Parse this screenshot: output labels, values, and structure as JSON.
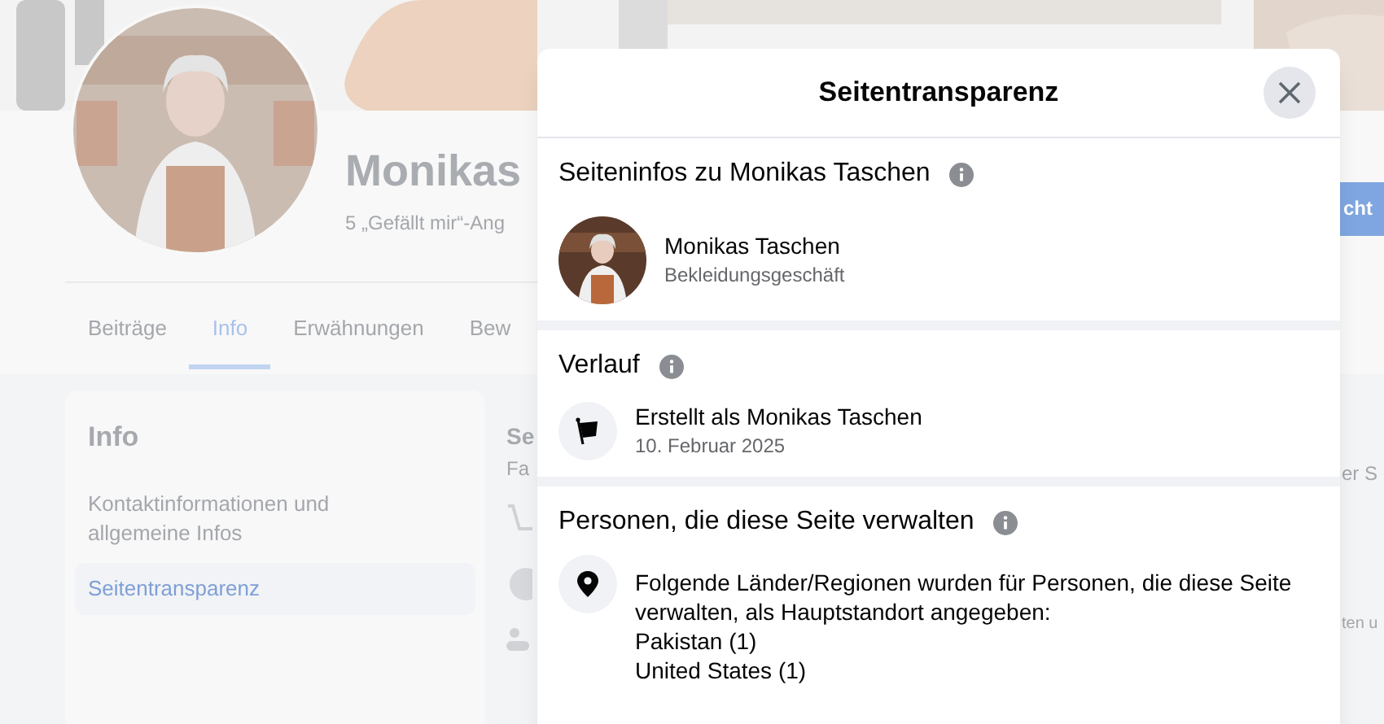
{
  "background_page": {
    "page_name": "Monikas",
    "likes": "5 „Gefällt mir“-Ang",
    "tabs": [
      {
        "label": "Beiträge",
        "selected": false
      },
      {
        "label": "Info",
        "selected": true
      },
      {
        "label": "Erwähnungen",
        "selected": false
      },
      {
        "label": "Bew",
        "selected": false
      }
    ],
    "info_card": {
      "title": "Info",
      "items": [
        {
          "label": "Kontaktinformationen und allgemeine Infos",
          "selected": false
        },
        {
          "label": "Seitentransparenz",
          "selected": true
        }
      ]
    },
    "middle_column": {
      "heading": "Se",
      "subheading": "Fa"
    },
    "right_edge": {
      "button": "cht",
      "texts": [
        "er S",
        "ten u"
      ]
    }
  },
  "dialog": {
    "title": "Seitentransparenz",
    "sections": [
      {
        "kind": "page",
        "heading": "Seiteninfos zu Monikas Taschen",
        "name": "Monikas Taschen",
        "category": "Bekleidungsgeschäft"
      },
      {
        "kind": "history",
        "heading": "Verlauf",
        "title": "Erstellt als Monikas Taschen",
        "date": "10. Februar 2025"
      },
      {
        "kind": "location",
        "heading": "Personen, die diese Seite verwalten",
        "text": "Folgende Länder/Regionen wurden für Personen, die diese Seite verwalten, als Hauptstandort angegeben:",
        "countries": [
          "Pakistan (1)",
          "United States (1)"
        ]
      }
    ]
  }
}
